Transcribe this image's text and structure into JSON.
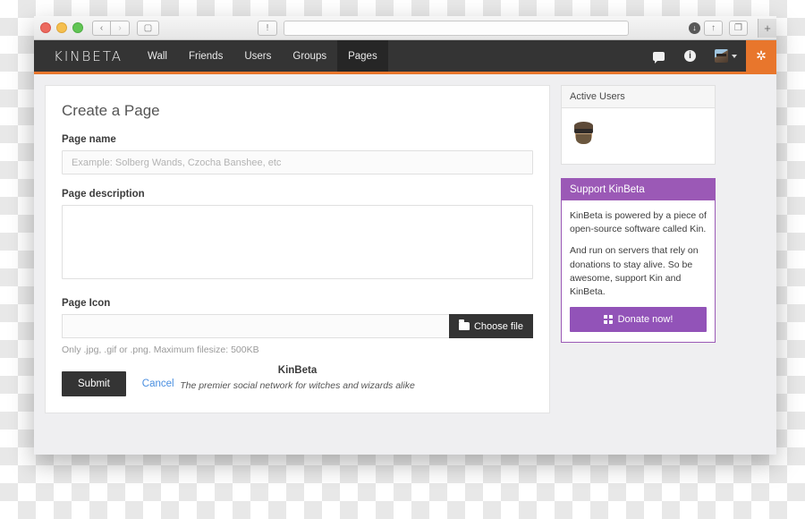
{
  "browser": {
    "traffic_lights": [
      "close",
      "minimize",
      "zoom"
    ],
    "back_label": "‹",
    "forward_label": "›",
    "url_value": "",
    "reload_glyph": "↻",
    "reader_glyph": "◫",
    "sidebar_glyph": "▢",
    "security_glyph": "!",
    "download_glyph": "↓",
    "share_glyph": "↑",
    "tabs_glyph": "❐",
    "new_tab_label": "+"
  },
  "navbar": {
    "brand": "KINBETA",
    "links": [
      {
        "label": "Wall",
        "active": false
      },
      {
        "label": "Friends",
        "active": false
      },
      {
        "label": "Users",
        "active": false
      },
      {
        "label": "Groups",
        "active": false
      },
      {
        "label": "Pages",
        "active": true
      }
    ],
    "messages_icon": "chat-icon",
    "notifications_icon": "info-icon",
    "notifications_label": "i",
    "settings_icon": "gear-icon",
    "settings_glyph": "✲"
  },
  "form": {
    "title": "Create a Page",
    "name_label": "Page name",
    "name_value": "",
    "name_placeholder": "Example: Solberg Wands, Czocha Banshee, etc",
    "description_label": "Page description",
    "description_value": "",
    "description_placeholder": "",
    "icon_label": "Page Icon",
    "file_value": "",
    "choose_file_label": "Choose file",
    "help_text": "Only .jpg, .gif or .png. Maximum filesize: 500KB",
    "submit_label": "Submit",
    "cancel_label": "Cancel"
  },
  "sidebar": {
    "active_users": {
      "title": "Active Users",
      "avatars": [
        "user-avatar-1"
      ]
    },
    "support": {
      "title": "Support KinBeta",
      "paragraphs": [
        "KinBeta is powered by a piece of open-source software called Kin.",
        "And run on servers that rely on donations to stay alive. So be awesome, support Kin and KinBeta."
      ],
      "donate_label": "Donate now!",
      "accent_color": "#9b59b6"
    }
  },
  "footer": {
    "title": "KinBeta",
    "tagline": "The premier social network for witches and wizards alike"
  },
  "status_bar": {
    "shield_icon": "shield-check-icon",
    "check_glyph": "✓"
  }
}
